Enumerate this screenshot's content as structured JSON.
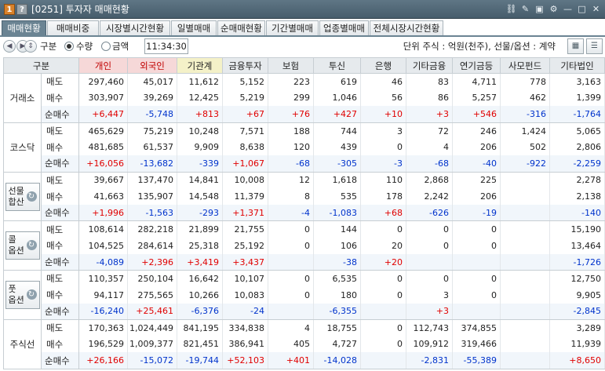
{
  "window": {
    "num1": "1",
    "num2": "?",
    "title": "[0251] 투자자 매매현황",
    "icons": [
      "link-icon",
      "memo-icon",
      "camera-icon",
      "gear-icon",
      "minimize-icon",
      "maximize-icon",
      "close-icon"
    ],
    "icon_glyphs": [
      "⛓",
      "✎",
      "▣",
      "⚙",
      "—",
      "□",
      "✕"
    ]
  },
  "tabs": [
    "매매현황",
    "매매비중",
    "시장별시간현황",
    "일별매매",
    "순매매현황",
    "기간별매매",
    "업종별매매",
    "전체시장시간현황"
  ],
  "active_tab": 0,
  "toolbar": {
    "category_label": "구분",
    "radio_quantity": "수량",
    "radio_amount": "금액",
    "selected": "수량",
    "time": "11:34:30",
    "unit_text": "단위 주식 : 억원(천주), 선물/옵션 : 계약",
    "btn_grid_icon": "table-icon",
    "btn_list_icon": "list-icon"
  },
  "colors": {
    "positive": "#e00000",
    "negative": "#0033cc",
    "tab_active": "#6b8493",
    "header_individual": "#f6d8d8",
    "header_institution": "#f4f1c8"
  },
  "table": {
    "headers": [
      "구분",
      "",
      "개인",
      "외국인",
      "기관계",
      "금융투자",
      "보험",
      "투신",
      "은행",
      "기타금융",
      "연기금등",
      "사모펀드",
      "기타법인"
    ],
    "groups": [
      {
        "name": "거래소",
        "button": false,
        "rows": [
          {
            "label": "매도",
            "values": [
              "297,460",
              "45,017",
              "11,612",
              "5,152",
              "223",
              "619",
              "46",
              "83",
              "4,711",
              "778",
              "3,163"
            ]
          },
          {
            "label": "매수",
            "values": [
              "303,907",
              "39,269",
              "12,425",
              "5,219",
              "299",
              "1,046",
              "56",
              "86",
              "5,257",
              "462",
              "1,399"
            ]
          },
          {
            "label": "순매수",
            "values": [
              "+6,447",
              "-5,748",
              "+813",
              "+67",
              "+76",
              "+427",
              "+10",
              "+3",
              "+546",
              "-316",
              "-1,764"
            ]
          }
        ]
      },
      {
        "name": "코스닥",
        "button": false,
        "rows": [
          {
            "label": "매도",
            "values": [
              "465,629",
              "75,219",
              "10,248",
              "7,571",
              "188",
              "744",
              "3",
              "72",
              "246",
              "1,424",
              "5,065"
            ]
          },
          {
            "label": "매수",
            "values": [
              "481,685",
              "61,537",
              "9,909",
              "8,638",
              "120",
              "439",
              "0",
              "4",
              "206",
              "502",
              "2,806"
            ]
          },
          {
            "label": "순매수",
            "values": [
              "+16,056",
              "-13,682",
              "-339",
              "+1,067",
              "-68",
              "-305",
              "-3",
              "-68",
              "-40",
              "-922",
              "-2,259"
            ]
          }
        ]
      },
      {
        "name": "선물합산",
        "button": true,
        "lines": [
          "선물",
          "합산"
        ],
        "rows": [
          {
            "label": "매도",
            "values": [
              "39,667",
              "137,470",
              "14,841",
              "10,008",
              "12",
              "1,618",
              "110",
              "2,868",
              "225",
              "",
              "2,278"
            ]
          },
          {
            "label": "매수",
            "values": [
              "41,663",
              "135,907",
              "14,548",
              "11,379",
              "8",
              "535",
              "178",
              "2,242",
              "206",
              "",
              "2,138"
            ]
          },
          {
            "label": "순매수",
            "values": [
              "+1,996",
              "-1,563",
              "-293",
              "+1,371",
              "-4",
              "-1,083",
              "+68",
              "-626",
              "-19",
              "",
              "-140"
            ]
          }
        ]
      },
      {
        "name": "콜옵션",
        "button": true,
        "lines": [
          "콜",
          "옵션"
        ],
        "rows": [
          {
            "label": "매도",
            "values": [
              "108,614",
              "282,218",
              "21,899",
              "21,755",
              "0",
              "144",
              "0",
              "0",
              "0",
              "",
              "15,190"
            ]
          },
          {
            "label": "매수",
            "values": [
              "104,525",
              "284,614",
              "25,318",
              "25,192",
              "0",
              "106",
              "20",
              "0",
              "0",
              "",
              "13,464"
            ]
          },
          {
            "label": "순매수",
            "values": [
              "-4,089",
              "+2,396",
              "+3,419",
              "+3,437",
              "",
              "-38",
              "+20",
              "",
              "",
              "",
              "-1,726"
            ]
          }
        ]
      },
      {
        "name": "풋옵션",
        "button": true,
        "lines": [
          "풋",
          "옵션"
        ],
        "rows": [
          {
            "label": "매도",
            "values": [
              "110,357",
              "250,104",
              "16,642",
              "10,107",
              "0",
              "6,535",
              "0",
              "0",
              "0",
              "",
              "12,750"
            ]
          },
          {
            "label": "매수",
            "values": [
              "94,117",
              "275,565",
              "10,266",
              "10,083",
              "0",
              "180",
              "0",
              "3",
              "0",
              "",
              "9,905"
            ]
          },
          {
            "label": "순매수",
            "values": [
              "-16,240",
              "+25,461",
              "-6,376",
              "-24",
              "",
              "-6,355",
              "",
              "+3",
              "",
              "",
              "-2,845"
            ]
          }
        ]
      },
      {
        "name": "주식선",
        "button": false,
        "rows": [
          {
            "label": "매도",
            "values": [
              "170,363",
              "1,024,449",
              "841,195",
              "334,838",
              "4",
              "18,755",
              "0",
              "112,743",
              "374,855",
              "",
              "3,289"
            ]
          },
          {
            "label": "매수",
            "values": [
              "196,529",
              "1,009,377",
              "821,451",
              "386,941",
              "405",
              "4,727",
              "0",
              "109,912",
              "319,466",
              "",
              "11,939"
            ]
          },
          {
            "label": "순매수",
            "values": [
              "+26,166",
              "-15,072",
              "-19,744",
              "+52,103",
              "+401",
              "-14,028",
              "",
              "-2,831",
              "-55,389",
              "",
              "+8,650"
            ]
          }
        ]
      }
    ]
  }
}
